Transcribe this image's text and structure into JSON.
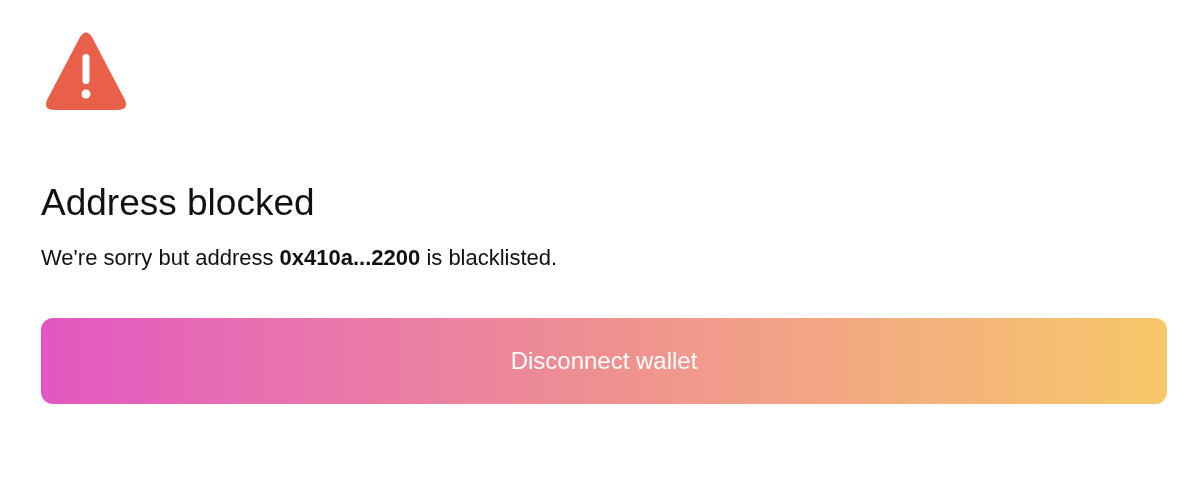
{
  "alert": {
    "title": "Address blocked",
    "message": "We're sorry but address **0x410a...2200** is blacklisted.",
    "button": "Disconnect wallet"
  }
}
